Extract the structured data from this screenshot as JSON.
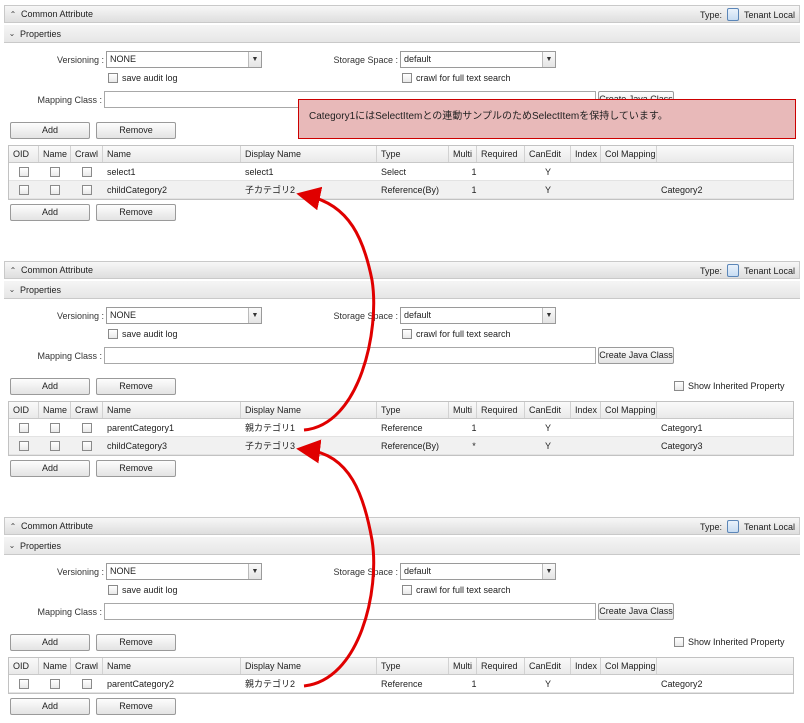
{
  "notice": "Category1にはSelectItemとの連動サンプルのためSelectItemを保持しています。",
  "labels": {
    "common_attribute": "Common Attribute",
    "type_label": "Type:",
    "type_value": "Tenant Local",
    "properties": "Properties",
    "versioning": "Versioning :",
    "versioning_value": "NONE",
    "storage_space": "Storage Space :",
    "storage_value": "default",
    "save_audit_log": "save audit log",
    "crawl_full_text": "crawl for full text search",
    "mapping_class": "Mapping Class :",
    "create_java_class": "Create Java Class",
    "add": "Add",
    "remove": "Remove",
    "show_inherited": "Show Inherited Property",
    "collapse_icon": "chevron-up-icon",
    "expand_icon": "chevron-down-icon",
    "type_icon": "document-icon"
  },
  "columns": [
    "OID",
    "Name",
    "Crawl",
    "Name",
    "Display Name",
    "Type",
    "Multi",
    "Required",
    "CanEdit",
    "Index",
    "Col Mapping"
  ],
  "panels": [
    {
      "rows": [
        {
          "name": "select1",
          "display": "select1",
          "type": "Select",
          "multi": "1",
          "required": "",
          "canedit": "Y",
          "index": "",
          "colmap": ""
        },
        {
          "name": "childCategory2",
          "display": "子カテゴリ2",
          "type": "Reference(By)",
          "multi": "1",
          "required": "",
          "canedit": "Y",
          "index": "",
          "colmap": "Category2"
        }
      ]
    },
    {
      "rows": [
        {
          "name": "parentCategory1",
          "display": "親カテゴリ1",
          "type": "Reference",
          "multi": "1",
          "required": "",
          "canedit": "Y",
          "index": "",
          "colmap": "Category1"
        },
        {
          "name": "childCategory3",
          "display": "子カテゴリ3",
          "type": "Reference(By)",
          "multi": "*",
          "required": "",
          "canedit": "Y",
          "index": "",
          "colmap": "Category3"
        }
      ]
    },
    {
      "rows": [
        {
          "name": "parentCategory2",
          "display": "親カテゴリ2",
          "type": "Reference",
          "multi": "1",
          "required": "",
          "canedit": "Y",
          "index": "",
          "colmap": "Category2"
        }
      ]
    }
  ],
  "colors": {
    "arrow": "#e00000",
    "notice_bg": "#e8b9b9",
    "notice_border": "#cc0000"
  }
}
